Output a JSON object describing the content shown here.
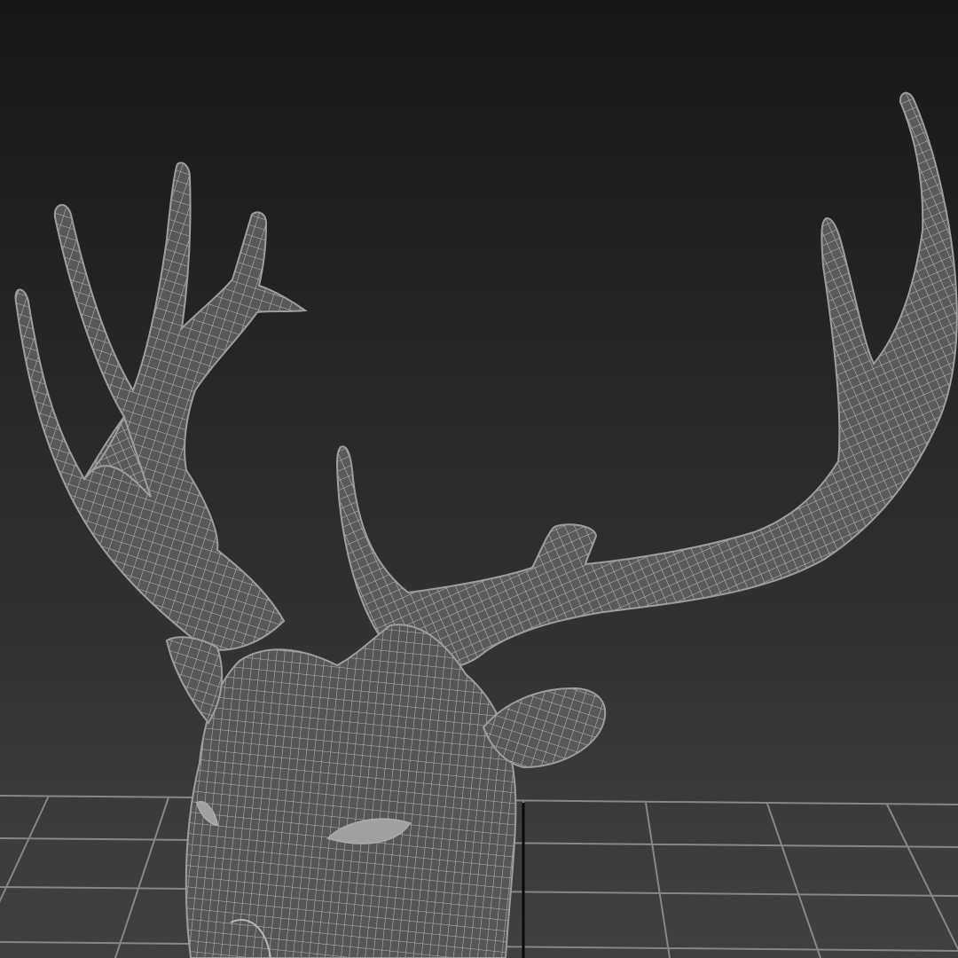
{
  "viewport": {
    "mode": "wireframe",
    "background_top": "#171717",
    "background_bottom": "#404040",
    "grid_color": "#8a8a8a",
    "axis_color": "#0a0a0a",
    "wire_color": "#b4b4b4",
    "model_fill": "#5c5c5c",
    "model_name_icon": "deer-head-icon"
  }
}
